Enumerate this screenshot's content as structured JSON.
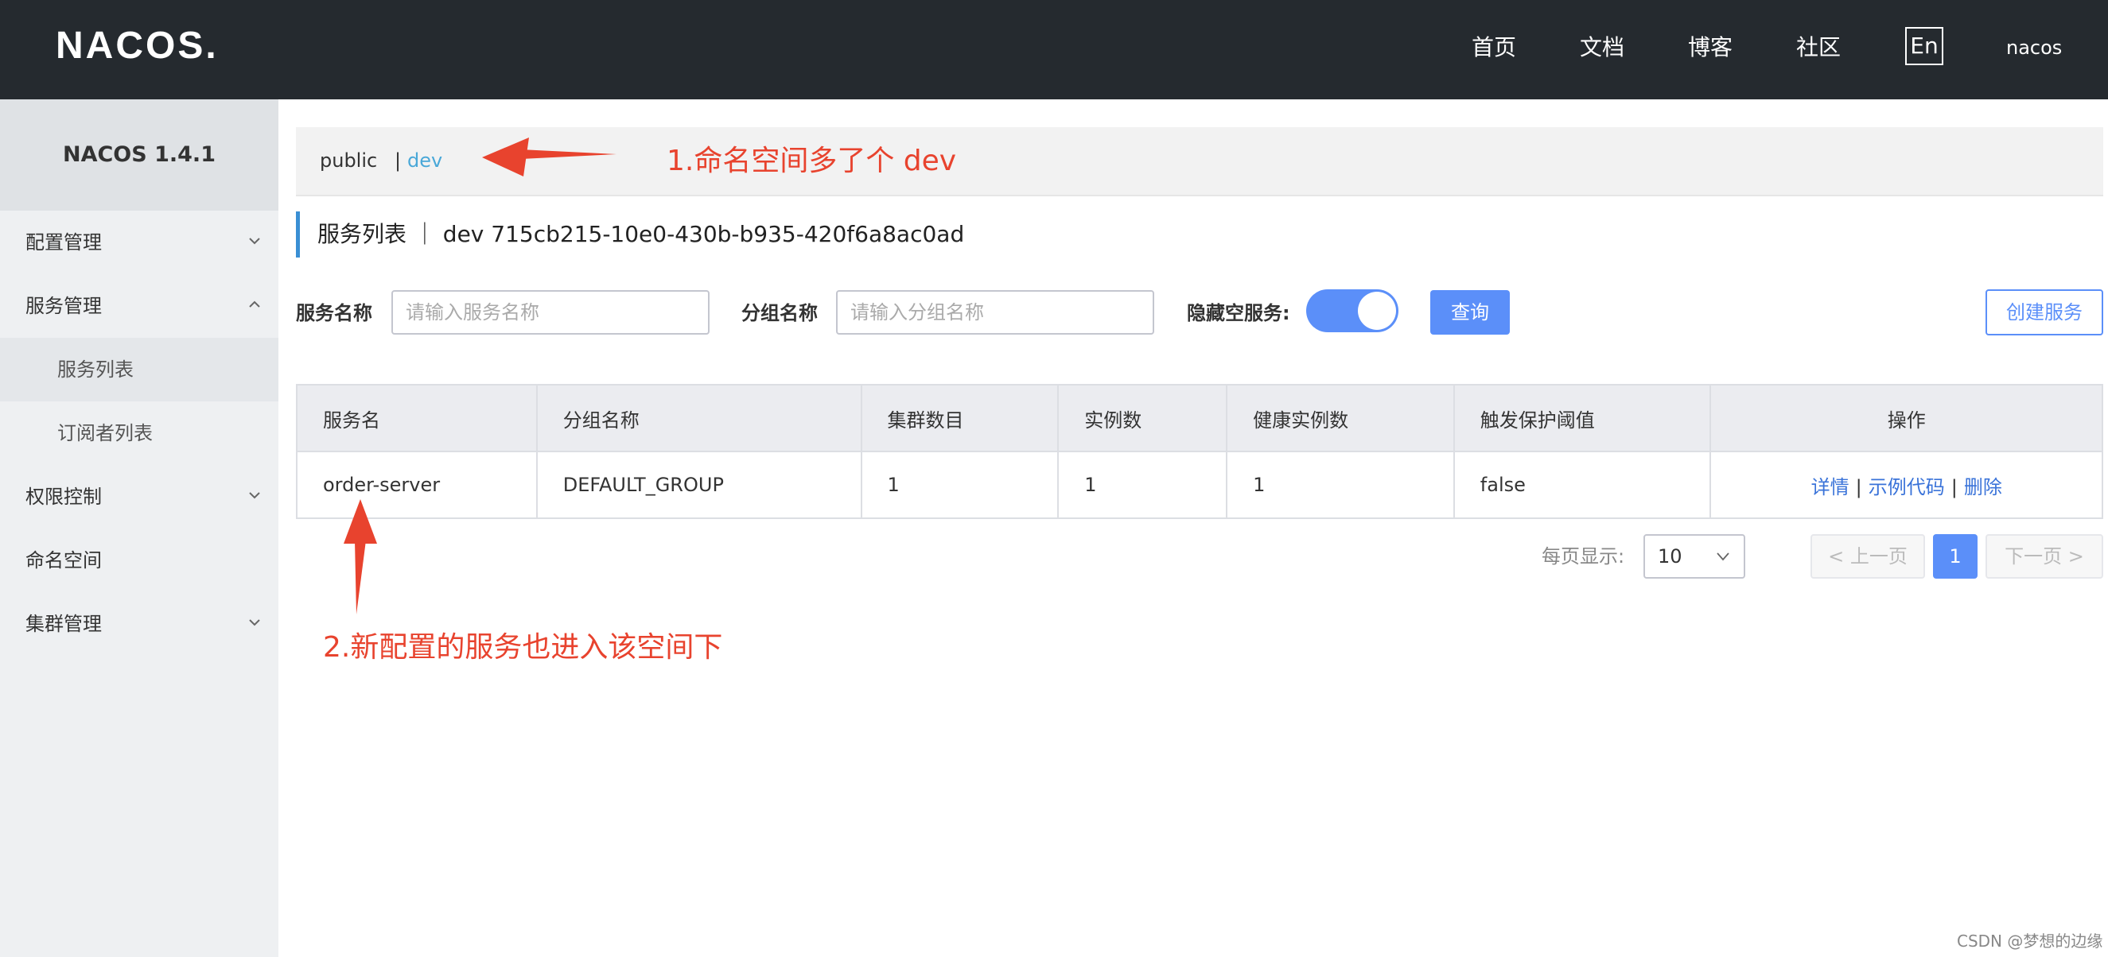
{
  "header": {
    "logo": "NACOS.",
    "nav": [
      "首页",
      "文档",
      "博客",
      "社区"
    ],
    "lang_button": "En",
    "user": "nacos"
  },
  "sidebar": {
    "title": "NACOS 1.4.1",
    "items": [
      {
        "label": "配置管理",
        "icon": "chevron-down-icon"
      },
      {
        "label": "服务管理",
        "icon": "chevron-up-icon"
      },
      {
        "label": "服务列表"
      },
      {
        "label": "订阅者列表"
      },
      {
        "label": "权限控制",
        "icon": "chevron-down-icon"
      },
      {
        "label": "命名空间"
      },
      {
        "label": "集群管理",
        "icon": "chevron-down-icon"
      }
    ]
  },
  "namespaces": {
    "public": "public",
    "separator": "|",
    "dev": "dev"
  },
  "annotations": {
    "first": "1.命名空间多了个 dev",
    "second": "2.新配置的服务也进入该空间下",
    "color": "#e8432e"
  },
  "page_title": "服务列表 ｜ dev  715cb215-10e0-430b-b935-420f6a8ac0ad",
  "filters": {
    "service_name_label": "服务名称",
    "service_name_placeholder": "请输入服务名称",
    "group_name_label": "分组名称",
    "group_name_placeholder": "请输入分组名称",
    "hide_empty_label": "隐藏空服务:",
    "hide_empty_on": true,
    "query_button": "查询",
    "create_button": "创建服务"
  },
  "table": {
    "columns": [
      "服务名",
      "分组名称",
      "集群数目",
      "实例数",
      "健康实例数",
      "触发保护阈值",
      "操作"
    ],
    "rows": [
      {
        "cells": [
          "order-server",
          "DEFAULT_GROUP",
          "1",
          "1",
          "1",
          "false"
        ],
        "actions": [
          "详情",
          "示例代码",
          "删除"
        ]
      }
    ]
  },
  "pagination": {
    "page_size_label": "每页显示:",
    "page_size": "10",
    "prev": "上一页",
    "current": "1",
    "next": "下一页"
  },
  "watermark": "CSDN @梦想的边缘",
  "colors": {
    "accent": "#5b8ff9",
    "header_bg": "#252a2f",
    "link": "#3a73d9",
    "namespace_active": "#4aa8d8"
  }
}
